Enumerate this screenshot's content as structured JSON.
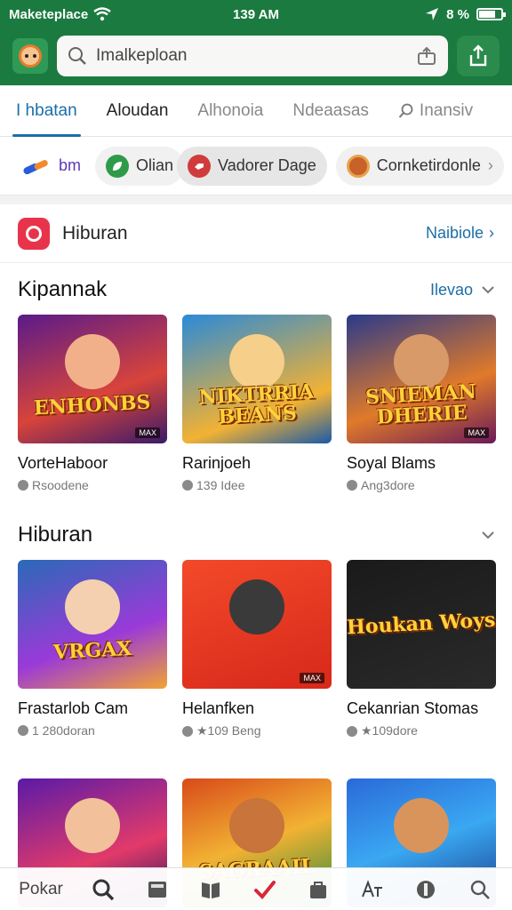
{
  "status": {
    "carrier": "Maketeplace",
    "time": "139 AM",
    "right_text": "8 %"
  },
  "header": {
    "search_placeholder": "Imalkeploan"
  },
  "tabs": [
    {
      "label": "I hbatan",
      "active": true
    },
    {
      "label": "Aloudan"
    },
    {
      "label": "Alhonoia"
    },
    {
      "label": "Ndeaasas"
    },
    {
      "label": "Inansiv"
    }
  ],
  "chips": [
    {
      "label": "bm",
      "color": "#3a5bd9"
    },
    {
      "label": "Olian",
      "color": "#2e9b48"
    },
    {
      "label": "Vadorer Dage",
      "color": "#d23b3b"
    },
    {
      "label": "Cornketirdonle",
      "color": "#c9612a"
    }
  ],
  "section": {
    "title": "Hiburan",
    "link": "Naibiole"
  },
  "groups": [
    {
      "title": "Kipannak",
      "link": "Ilevao",
      "cards": [
        {
          "title": "VorteHaboor",
          "meta": "Rsoodene",
          "thumb_text": "ENHONBS",
          "bg": "linear-gradient(160deg,#5a1a8a,#d8443a 60%,#3a1a6a)",
          "fig": "#f2b08a",
          "tag": "MAX"
        },
        {
          "title": "Rarinjoeh",
          "meta": "139 Idee",
          "thumb_text": "NIKTRRIA BEANS",
          "bg": "linear-gradient(160deg,#2a8ad8,#f2b233 70%,#1a5aa8)",
          "fig": "#f6cf8a",
          "tag": ""
        },
        {
          "title": "Soyal Blams",
          "meta": "Ang3dore",
          "thumb_text": "SNIEMAN DHERIE",
          "bg": "linear-gradient(160deg,#2a3a8a,#e07a2a 60%,#6a1a5a)",
          "fig": "#d99a6a",
          "tag": "MAX"
        }
      ]
    },
    {
      "title": "Hiburan",
      "link": "",
      "cards": [
        {
          "title": "Frastarlob Cam",
          "meta": "1 280doran",
          "thumb_text": "VRGAX",
          "bg": "linear-gradient(160deg,#2a6ab8,#9a3ad8 60%,#f2a233)",
          "fig": "#f4d0b0",
          "tag": ""
        },
        {
          "title": "Helanfken",
          "meta": "★109 Beng",
          "thumb_text": "",
          "bg": "linear-gradient(160deg,#f24a2a,#d8281a)",
          "fig": "#3a3a3a",
          "tag": "MAX"
        },
        {
          "title": "Cekanrian Stomas",
          "meta": "★109dore",
          "thumb_text": "Houkan Woys",
          "bg": "linear-gradient(160deg,#1a1a1a,#2a2a2a)",
          "fig": "",
          "tag": ""
        }
      ]
    },
    {
      "title": "",
      "link": "",
      "cards": [
        {
          "title": "",
          "meta": "",
          "thumb_text": "",
          "bg": "linear-gradient(160deg,#5a1aa8,#e23a6a 60%,#2a1a5a)",
          "fig": "#f2c09a",
          "tag": ""
        },
        {
          "title": "",
          "meta": "",
          "thumb_text": "SAGRAAIL",
          "bg": "linear-gradient(160deg,#d84a1a,#f2b233 50%,#2a8a3a)",
          "fig": "#c8743a",
          "tag": ""
        },
        {
          "title": "",
          "meta": "",
          "thumb_text": "",
          "bg": "linear-gradient(160deg,#2a6ad8,#3aa8f2 50%,#1a3a8a)",
          "fig": "#d8945a",
          "tag": ""
        }
      ]
    }
  ],
  "bottom_nav": {
    "label": "Pokar",
    "icons": [
      "search-icon",
      "film-icon",
      "book-icon",
      "check-icon",
      "bag-icon",
      "translate-icon",
      "apps-icon",
      "search-alt-icon"
    ]
  }
}
